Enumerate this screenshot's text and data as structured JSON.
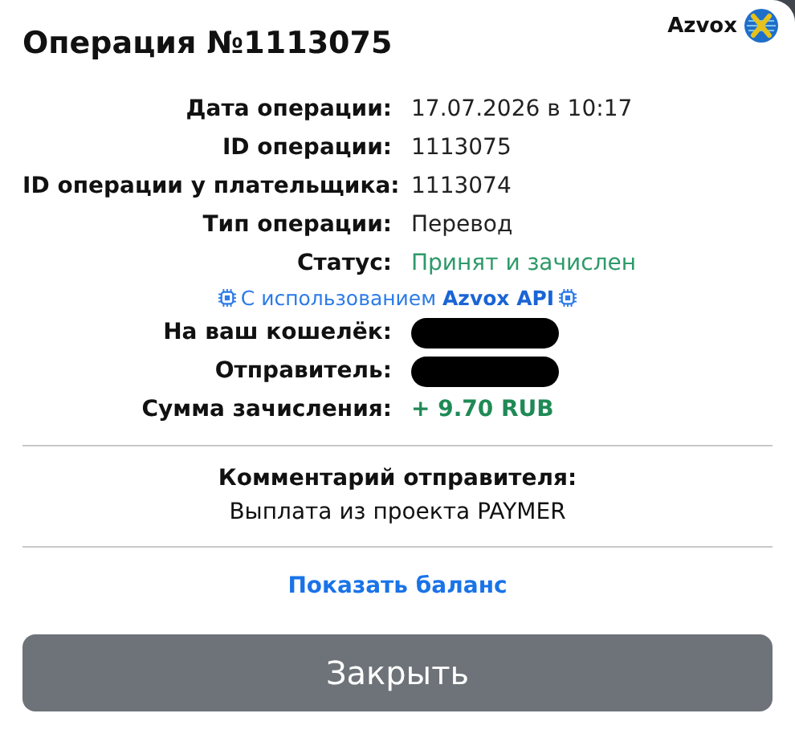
{
  "brand": {
    "name": "Azvox"
  },
  "title": "Операция №1113075",
  "details": [
    {
      "label": "Дата операции:",
      "kind": "text",
      "value": "17.07.2026 в 10:17"
    },
    {
      "label": "ID операции:",
      "kind": "text",
      "value": "1113075"
    },
    {
      "label": "ID операции у плательщика:",
      "kind": "text",
      "value": "1113074"
    },
    {
      "label": "Тип операции:",
      "kind": "text",
      "value": "Перевод"
    },
    {
      "label": "Статус:",
      "kind": "status",
      "value": "Принят и зачислен"
    }
  ],
  "api_note": "С использованием **Azvox API**",
  "parties": [
    {
      "label": "На ваш кошелёк:",
      "kind": "redacted"
    },
    {
      "label": "Отправитель:",
      "kind": "redacted"
    },
    {
      "label": "Сумма зачисления:",
      "kind": "amount",
      "value": "+ 9.70 RUB"
    }
  ],
  "comment": {
    "heading": "Комментарий отправителя:",
    "text": "Выплата из проекта PAYMER"
  },
  "balance_link": "Показать баланс",
  "close_button": "Закрыть"
}
